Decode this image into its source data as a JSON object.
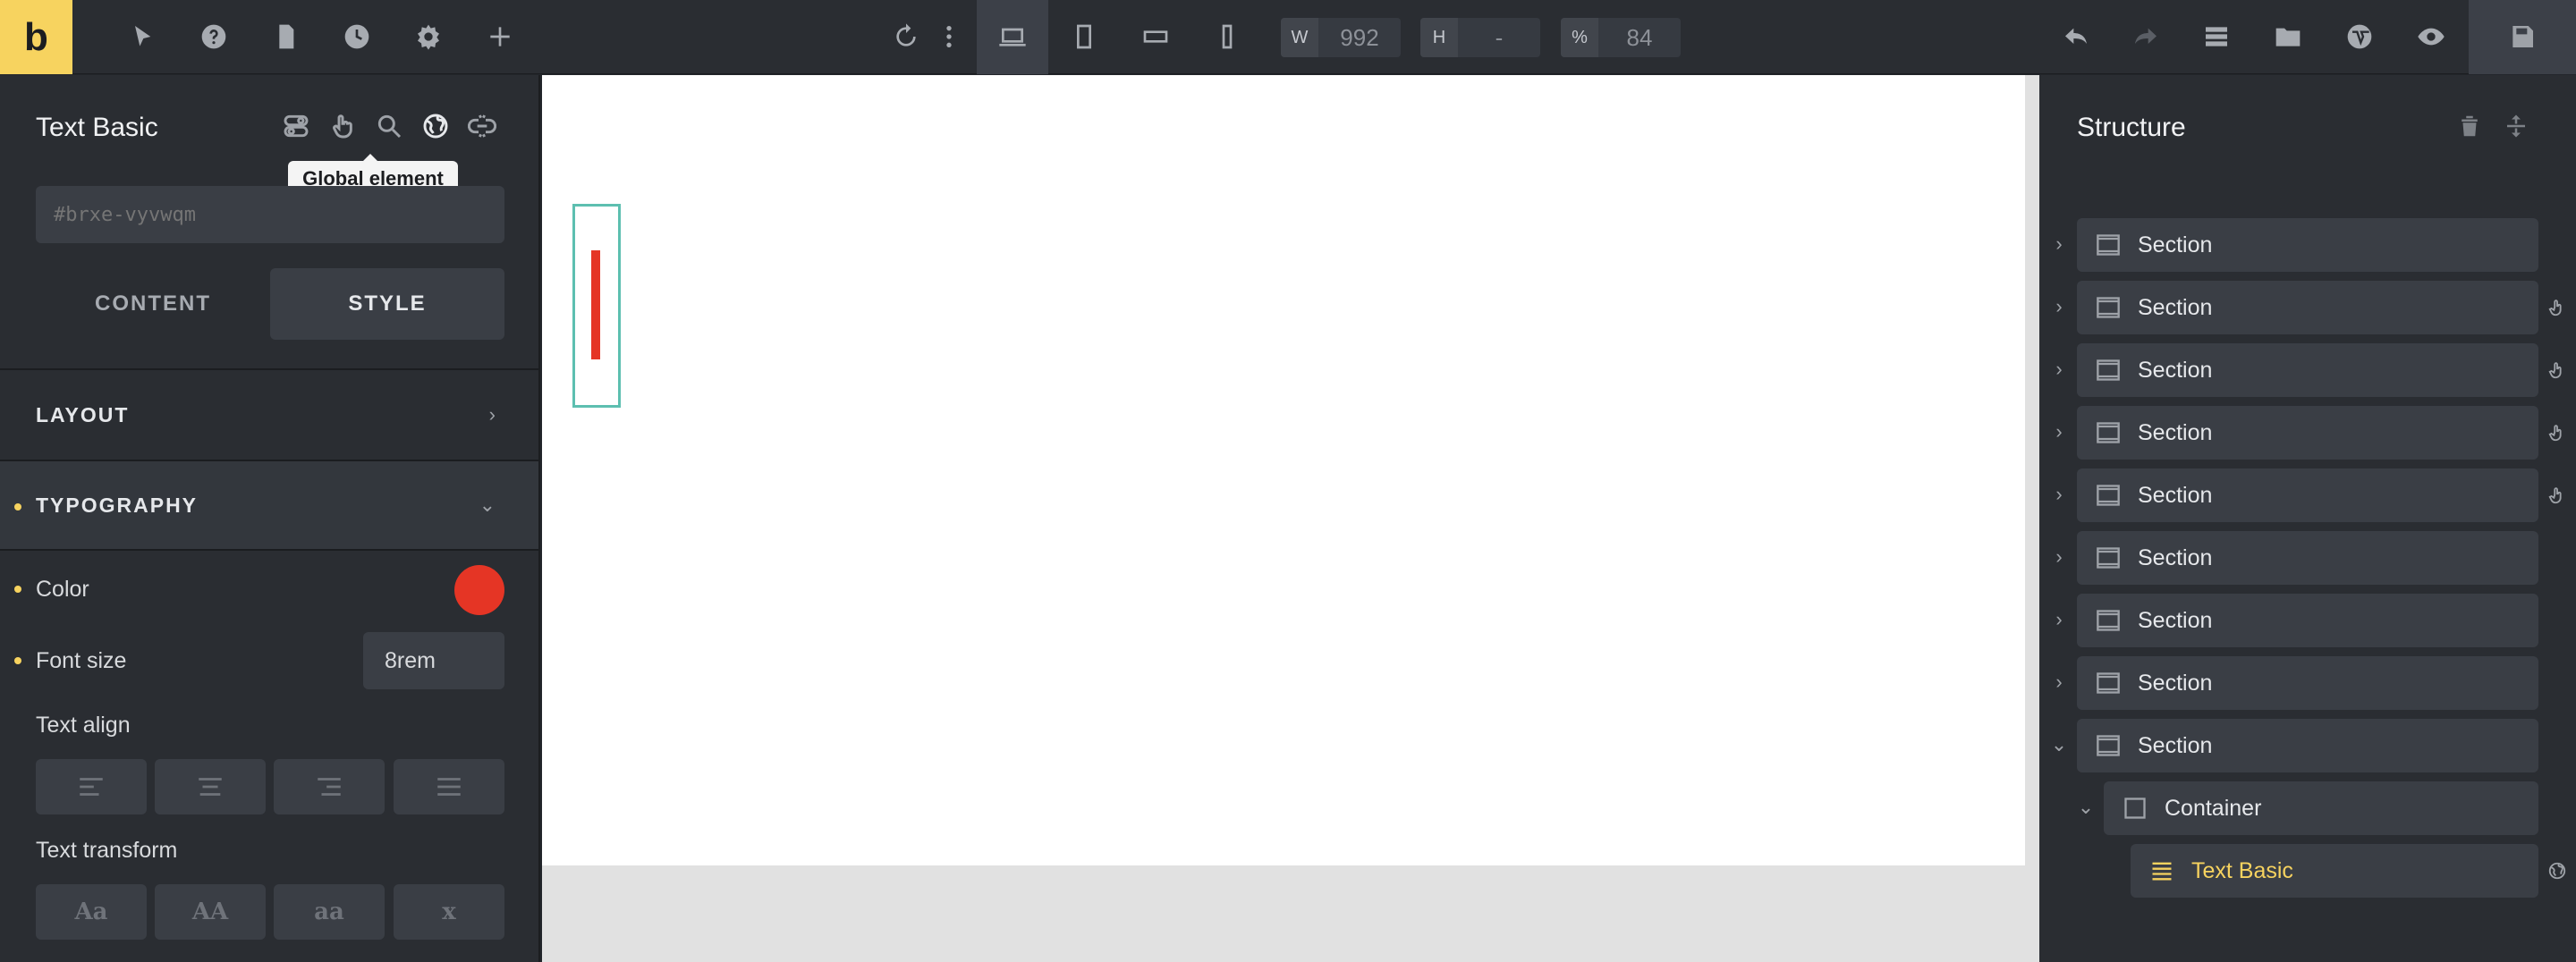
{
  "topbar": {
    "logo": "b",
    "width_label": "W",
    "width_value": "992",
    "height_label": "H",
    "height_value": "-",
    "zoom_label": "%",
    "zoom_value": "84"
  },
  "left_panel": {
    "title": "Text Basic",
    "tooltip": "Global element",
    "id_placeholder": "#brxe-vyvwqm",
    "tabs": [
      "CONTENT",
      "STYLE"
    ],
    "active_tab": "STYLE",
    "sections": {
      "layout": "LAYOUT",
      "typography": "TYPOGRAPHY"
    },
    "color_label": "Color",
    "color_value": "#e53525",
    "font_size_label": "Font size",
    "font_size_value": "8rem",
    "text_align_label": "Text align",
    "text_transform_label": "Text transform",
    "text_transform_options": [
      "Aa",
      "AA",
      "aa",
      "x"
    ]
  },
  "structure": {
    "title": "Structure",
    "items": [
      {
        "label": "Section",
        "expanded": false
      },
      {
        "label": "Section",
        "expanded": false
      },
      {
        "label": "Section",
        "expanded": false
      },
      {
        "label": "Section",
        "expanded": false
      },
      {
        "label": "Section",
        "expanded": false
      },
      {
        "label": "Section",
        "expanded": false
      },
      {
        "label": "Section",
        "expanded": false
      },
      {
        "label": "Section",
        "expanded": false
      },
      {
        "label": "Section",
        "expanded": true
      },
      {
        "label": "Container",
        "expanded": true
      },
      {
        "label": "Text Basic",
        "selected": true
      }
    ]
  },
  "colors": {
    "accent": "#f7d35f",
    "text_color": "#e53525",
    "selection": "#5dbfb0"
  }
}
